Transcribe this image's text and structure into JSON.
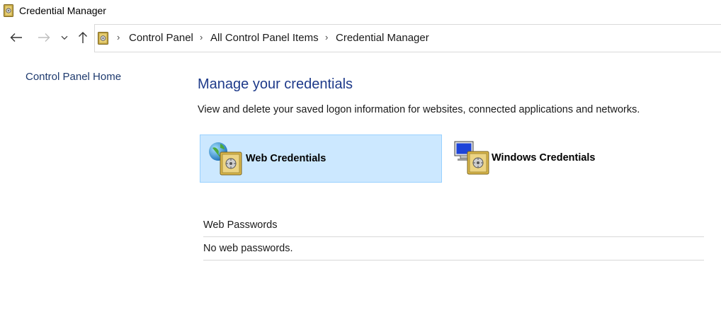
{
  "window": {
    "title": "Credential Manager",
    "icon": "credential-vault-icon"
  },
  "nav": {
    "back_icon": "arrow-left-icon",
    "forward_icon": "arrow-right-icon",
    "recent_icon": "chevron-down-icon",
    "up_icon": "arrow-up-icon",
    "breadcrumbs": [
      "Control Panel",
      "All Control Panel Items",
      "Credential Manager"
    ]
  },
  "sidebar": {
    "home_link": "Control Panel Home"
  },
  "main": {
    "title": "Manage your credentials",
    "description": "View and delete your saved logon information for websites, connected applications and networks.",
    "tiles": [
      {
        "label": "Web Credentials",
        "icon": "globe-vault-icon",
        "selected": true
      },
      {
        "label": "Windows Credentials",
        "icon": "monitor-vault-icon",
        "selected": false
      }
    ],
    "section": {
      "header": "Web Passwords",
      "empty_message": "No web passwords."
    }
  },
  "colors": {
    "selected_tile_bg": "#cce8ff",
    "selected_tile_border": "#99d1ff",
    "title_blue": "#1e3a8a",
    "link_blue": "#1e3a6e"
  }
}
